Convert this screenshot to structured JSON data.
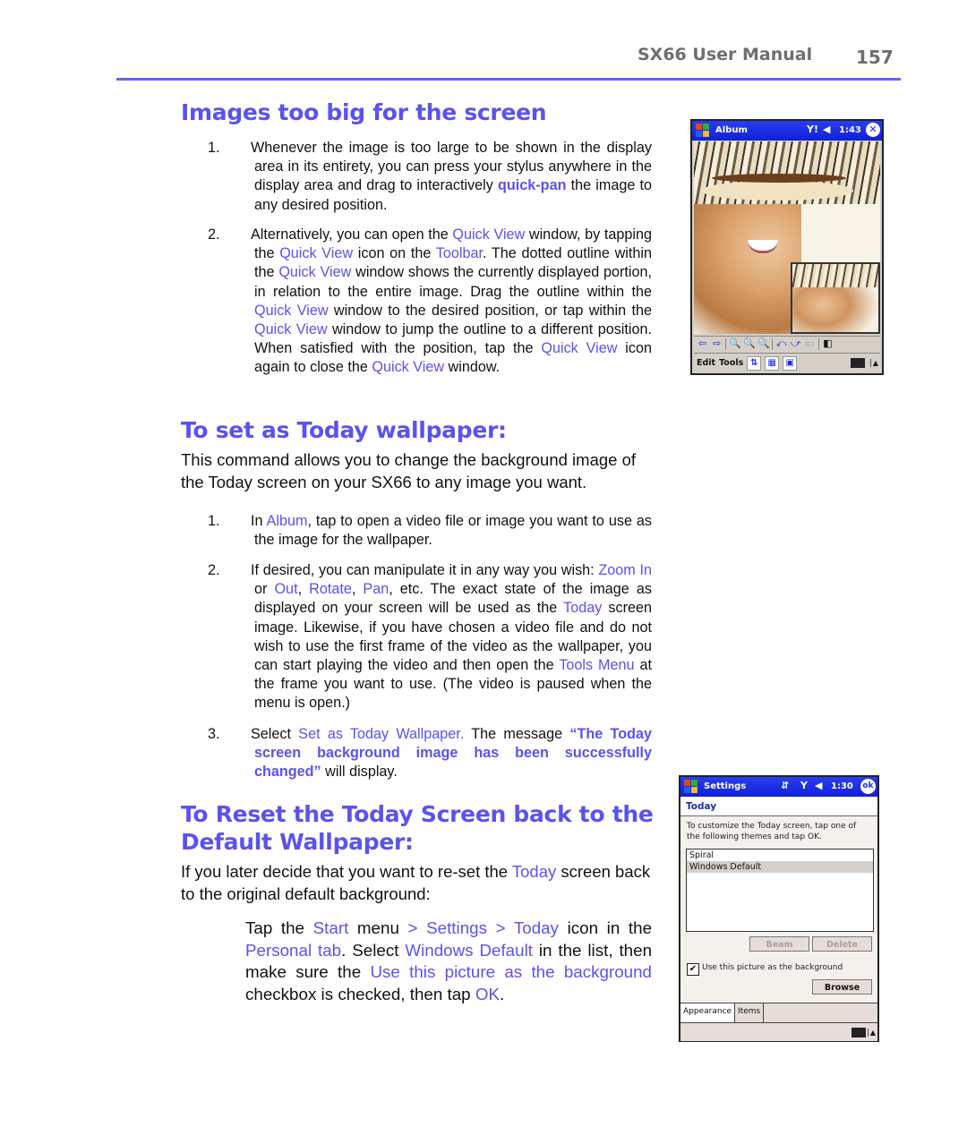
{
  "header": {
    "title": "SX66 User Manual",
    "page_number": "157"
  },
  "sections": [
    {
      "heading": "Images too big for the screen",
      "items": [
        {
          "num": "1.",
          "parts": [
            {
              "t": "Whenever the image is too large to be shown in the display area in its entirety, you can press your stylus anywhere in the display area and drag to interactively "
            },
            {
              "t": "quick-pan",
              "hl": true,
              "bold": true
            },
            {
              "t": " the image to any desired position."
            }
          ]
        },
        {
          "num": "2.",
          "parts": [
            {
              "t": "Alternatively, you can open the "
            },
            {
              "t": "Quick View",
              "hl": true
            },
            {
              "t": " window, by tapping the "
            },
            {
              "t": "Quick View",
              "hl": true
            },
            {
              "t": " icon on the "
            },
            {
              "t": "Toolbar",
              "hl": true
            },
            {
              "t": ". The dotted outline within the "
            },
            {
              "t": "Quick View",
              "hl": true
            },
            {
              "t": " window shows the currently displayed portion, in relation to the entire image. Drag the outline within the "
            },
            {
              "t": "Quick View",
              "hl": true
            },
            {
              "t": " window to the desired position, or tap within the "
            },
            {
              "t": "Quick View",
              "hl": true
            },
            {
              "t": " window to jump the outline to a different position. When satisfied with the position, tap the "
            },
            {
              "t": "Quick View",
              "hl": true
            },
            {
              "t": " icon again to close the "
            },
            {
              "t": "Quick View",
              "hl": true
            },
            {
              "t": " window."
            }
          ]
        }
      ]
    },
    {
      "heading": "To set as Today wallpaper:",
      "intro": "This command allows you to change the background image of the Today screen on your SX66 to any image you want.",
      "items": [
        {
          "num": "1.",
          "parts": [
            {
              "t": "In "
            },
            {
              "t": "Album",
              "hl": true
            },
            {
              "t": ", tap to open a video file or image you want to use as the image for the wallpaper."
            }
          ]
        },
        {
          "num": "2.",
          "parts": [
            {
              "t": "If desired, you can manipulate it in any way you wish: "
            },
            {
              "t": "Zoom In",
              "hl": true
            },
            {
              "t": " or "
            },
            {
              "t": "Out",
              "hl": true
            },
            {
              "t": ", "
            },
            {
              "t": "Rotate",
              "hl": true
            },
            {
              "t": ", "
            },
            {
              "t": "Pan",
              "hl": true
            },
            {
              "t": ", etc. The exact state of the image as displayed on your screen will be used as the "
            },
            {
              "t": "Today",
              "hl": true
            },
            {
              "t": " screen image. Likewise, if you have chosen a video file and do not wish to use the first frame of the video as the wallpaper, you can start playing the video and then open the "
            },
            {
              "t": "Tools Menu",
              "hl": true
            },
            {
              "t": " at the frame you want to use. (The video is paused when the menu is open.)"
            }
          ]
        },
        {
          "num": "3.",
          "parts": [
            {
              "t": "Select "
            },
            {
              "t": "Set as Today Wallpaper.",
              "hl": true
            },
            {
              "t": " The message "
            },
            {
              "t": "“The Today screen background image has been successfully changed”",
              "hl": true,
              "bold": true
            },
            {
              "t": " will display."
            }
          ]
        }
      ]
    },
    {
      "heading": "To Reset the Today Screen back to the Default Wallpaper:",
      "intro_parts": [
        {
          "t": "If you later decide that you want to re-set the "
        },
        {
          "t": "Today",
          "hl": true
        },
        {
          "t": " screen back to the original default background:"
        }
      ],
      "steps_parts": [
        {
          "t": "Tap the "
        },
        {
          "t": "Start",
          "hl": true
        },
        {
          "t": " menu "
        },
        {
          "t": ">",
          "hl": true
        },
        {
          "t": " "
        },
        {
          "t": "Settings",
          "hl": true
        },
        {
          "t": " "
        },
        {
          "t": ">",
          "hl": true
        },
        {
          "t": " "
        },
        {
          "t": "Today",
          "hl": true
        },
        {
          "t": " icon in the "
        },
        {
          "t": "Personal tab",
          "hl": true
        },
        {
          "t": ". Select "
        },
        {
          "t": "Windows Default",
          "hl": true
        },
        {
          "t": " in the list, then make sure the "
        },
        {
          "t": "Use this picture as the background",
          "hl": true
        },
        {
          "t": " checkbox is checked, then tap "
        },
        {
          "t": "OK",
          "hl": true
        },
        {
          "t": "."
        }
      ]
    }
  ],
  "album_screen": {
    "title": "Album",
    "time": "1:43",
    "icons": [
      "windows-start-icon",
      "signal-icon",
      "volume-icon",
      "close-icon"
    ],
    "toolbar_icons": [
      "back-arrow-icon",
      "forward-arrow-icon",
      "zoom-out-icon",
      "zoom-in-icon",
      "zoom-fit-icon",
      "rotate-left-icon",
      "rotate-right-icon",
      "quick-view-icon",
      "fullscreen-icon"
    ],
    "menu": [
      "Edit",
      "Tools"
    ],
    "menu_icons": [
      "sort-icon",
      "grid-view-icon",
      "slideshow-icon",
      "keyboard-icon",
      "up-arrow-icon"
    ]
  },
  "settings_screen": {
    "title": "Settings",
    "time": "1:30",
    "ok_label": "ok",
    "section": "Today",
    "instructions": "To customize the Today screen, tap one of the following themes and tap OK.",
    "themes": [
      "Spiral",
      "Windows Default"
    ],
    "selected_theme": "Windows Default",
    "beam_label": "Beam",
    "delete_label": "Delete",
    "checkbox_label": "Use this picture as the background",
    "checkbox_checked": true,
    "browse_label": "Browse",
    "tabs": [
      "Appearance",
      "Items"
    ],
    "active_tab": "Appearance"
  },
  "colors": {
    "accent": "#5a52f0",
    "header_gray": "#6e6e6e",
    "pda_title": "#1a2ee8"
  }
}
